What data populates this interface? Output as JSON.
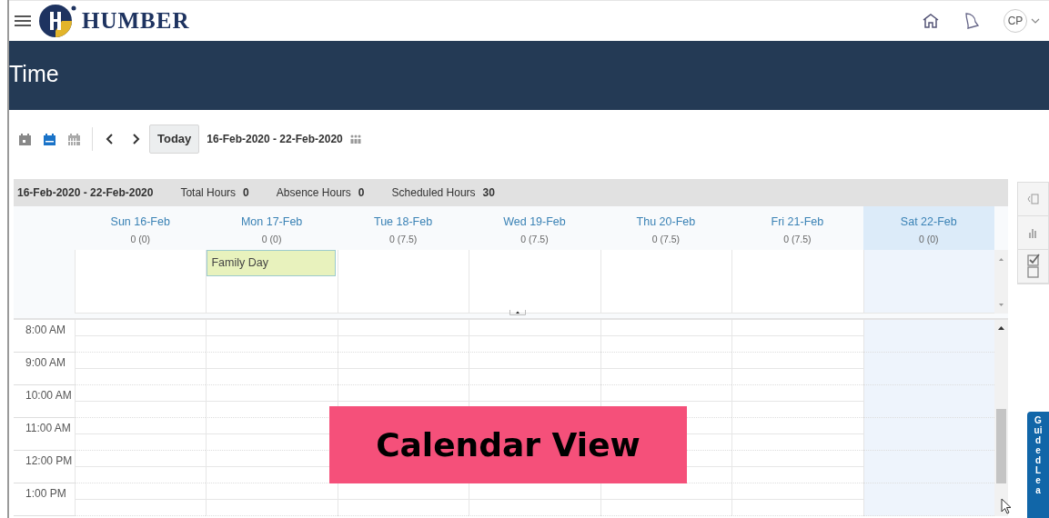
{
  "header": {
    "brand": "HUMBER",
    "avatar": "CP"
  },
  "title": "Time",
  "toolbar": {
    "views": [
      {
        "kind": "day",
        "selected": false
      },
      {
        "kind": "week",
        "selected": true
      },
      {
        "kind": "month",
        "selected": false
      }
    ],
    "today": "Today",
    "range": "16-Feb-2020 - 22-Feb-2020"
  },
  "summary": {
    "range": "16-Feb-2020 - 22-Feb-2020",
    "stats": [
      {
        "label": "Total Hours",
        "value": "0"
      },
      {
        "label": "Absence Hours",
        "value": "0"
      },
      {
        "label": "Scheduled Hours",
        "value": "30"
      }
    ]
  },
  "days": [
    {
      "name": "Sun 16-Feb",
      "hours": "0 (0)",
      "selected": false
    },
    {
      "name": "Mon 17-Feb",
      "hours": "0 (0)",
      "selected": false,
      "event": "Family Day"
    },
    {
      "name": "Tue 18-Feb",
      "hours": "0 (7.5)",
      "selected": false
    },
    {
      "name": "Wed 19-Feb",
      "hours": "0 (7.5)",
      "selected": false
    },
    {
      "name": "Thu 20-Feb",
      "hours": "0 (7.5)",
      "selected": false
    },
    {
      "name": "Fri 21-Feb",
      "hours": "0 (7.5)",
      "selected": false
    },
    {
      "name": "Sat 22-Feb",
      "hours": "0 (0)",
      "selected": true
    }
  ],
  "times": [
    "8:00 AM",
    "9:00 AM",
    "10:00 AM",
    "11:00 AM",
    "12:00 PM",
    "1:00 PM"
  ],
  "overlay": "Calendar View",
  "guided_tab": "Guided Lea"
}
